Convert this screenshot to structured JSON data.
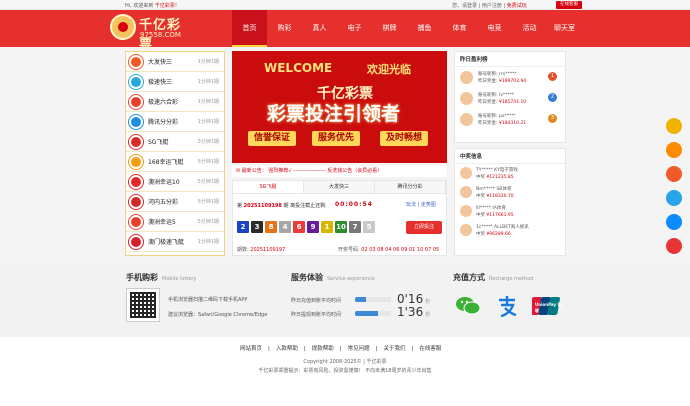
{
  "topbar": {
    "greeting": "Hi, 欢迎来到",
    "site_name": "千亿彩票",
    "greeting_end": "!",
    "right_links": "您，请登录 | 用户注册 |",
    "trial": "免费试玩",
    "service": "在线客服"
  },
  "logo": {
    "name": "千亿彩票",
    "domain": "97558.COM"
  },
  "menu": [
    "首页",
    "购彩",
    "真人",
    "电子",
    "棋牌",
    "捕鱼",
    "体育",
    "电竞",
    "活动",
    "聊天室"
  ],
  "games": [
    {
      "name": "大发快三",
      "time": "1分钟1期",
      "color": "#f15a24"
    },
    {
      "name": "极速快三",
      "time": "1分钟1期",
      "color": "#2aa7dd"
    },
    {
      "name": "极速六合彩",
      "time": "1分钟1期",
      "color": "#e8422f"
    },
    {
      "name": "腾讯分分彩",
      "time": "1分钟1期",
      "color": "#1f8de0"
    },
    {
      "name": "SG飞艇",
      "time": "3分钟1期",
      "color": "#d92a2a"
    },
    {
      "name": "168幸运飞艇",
      "time": "5分钟1期",
      "color": "#f49c11"
    },
    {
      "name": "澳洲幸运10",
      "time": "5分钟1期",
      "color": "#e32626"
    },
    {
      "name": "河内五分彩",
      "time": "5分钟1期",
      "color": "#cf2a2a"
    },
    {
      "name": "澳洲幸运5",
      "time": "5分钟1期",
      "color": "#e8422f"
    },
    {
      "name": "澳门极速飞艇",
      "time": "1分钟1期",
      "color": "#d3202a"
    }
  ],
  "banner": {
    "welcome_en": "WELCOME",
    "welcome_cn": "欢迎光临",
    "brand": "千亿彩票",
    "slogan": "彩票投注引领者",
    "pills": [
      "信誉保证",
      "服务优先",
      "及时畅想"
    ],
    "notice": "最新公告：  强烈推荐√ ------------------  反洗钱公告（会员必看）"
  },
  "lottery": {
    "tabs": [
      "SG飞艇",
      "大发快三",
      "腾讯分分彩"
    ],
    "issue_prefix": "第",
    "issue_number": "20251109198",
    "issue_suffix": "期 离投注截止还剩:",
    "countdown": "00:00:54",
    "links": "玩法 | 走势图",
    "balls": [
      {
        "n": "2",
        "c": "#1c44c2"
      },
      {
        "n": "3",
        "c": "#2b2b2b"
      },
      {
        "n": "8",
        "c": "#e47418"
      },
      {
        "n": "4",
        "c": "#a6a6a6"
      },
      {
        "n": "6",
        "c": "#e93c3c"
      },
      {
        "n": "9",
        "c": "#6a1b9a"
      },
      {
        "n": "1",
        "c": "#d4b800"
      },
      {
        "n": "10",
        "c": "#2e8b2e"
      },
      {
        "n": "7",
        "c": "#777777"
      },
      {
        "n": "5",
        "c": "#c9c9c9"
      }
    ],
    "bet_button": "立即投注",
    "prev_label": "期数:",
    "prev_issue": "20251109197",
    "open_label": "开奖号码:",
    "open_numbers": "02 03 08 04 06 09 01 10 07 05"
  },
  "ranking": {
    "title": "昨日盈利榜",
    "items": [
      {
        "user": "账号昵称: rrn*****",
        "amount_label": "昨日奖金:",
        "amount": "¥189703.94",
        "rank": "1",
        "color": "#e0532b"
      },
      {
        "user": "账号昵称: lv*****",
        "amount_label": "昨日奖金:",
        "amount": "¥185741.10",
        "rank": "2",
        "color": "#3a7ad8"
      },
      {
        "user": "账号昵称: po*****",
        "amount_label": "昨日奖金:",
        "amount": "¥184310.21",
        "rank": "3",
        "color": "#e08a1e"
      }
    ]
  },
  "winners": {
    "title": "中奖信息",
    "items": [
      {
        "user": "TY*****   KY电子游戏",
        "amount_label": "中奖",
        "amount": "¥121235.85"
      },
      {
        "user": "Nm*****   SB体育",
        "amount_label": "中奖",
        "amount": "¥118320.70"
      },
      {
        "user": "lll*****   IA体育",
        "amount_label": "中奖",
        "amount": "¥117661.95"
      },
      {
        "user": "1c*****   ALLBET真人视讯",
        "amount_label": "中奖",
        "amount": "¥96289.66"
      }
    ]
  },
  "side_icons": [
    {
      "name": "chat-icon",
      "color": "#f0b400"
    },
    {
      "name": "headset-icon",
      "color": "#ff8a00"
    },
    {
      "name": "gift-icon",
      "color": "#f25a2a"
    },
    {
      "name": "message-icon",
      "color": "#27a4ea"
    },
    {
      "name": "user-icon",
      "color": "#0a8cff"
    },
    {
      "name": "game-icon",
      "color": "#e53535"
    }
  ],
  "mobile": {
    "title": "手机购彩",
    "title_en": "Mobile lottery",
    "line1": "手机浏览器扫描二维码下载手机APP",
    "line2": "建议浏览器：Safari/Google Chrome/Edge"
  },
  "service_exp": {
    "title": "服务体验",
    "title_en": "Service experience",
    "rows": [
      {
        "label": "昨日充值到账平均时间",
        "value": "0'16",
        "unit": "秒",
        "level": 0.3
      },
      {
        "label": "昨日提现到账平均时间",
        "value": "1'36",
        "unit": "秒",
        "level": 0.65
      }
    ]
  },
  "recharge": {
    "title": "充值方式",
    "title_en": "Recharge method",
    "methods": [
      "wechat-pay-icon",
      "alipay-icon",
      "unionpay-icon"
    ],
    "unionpay_text": "UnionPay 银联"
  },
  "footer": {
    "links": [
      "网站首页",
      "|",
      "入款帮助",
      "|",
      "提款帮助",
      "|",
      "常见问题",
      "|",
      "关于我们",
      "|",
      "在线客服"
    ],
    "copyright": "Copyright  2008-2025©  |  千亿彩票",
    "disclaimer": "千亿彩票郑重提示：彩票有风险，投资需谨慎！  不向未满18周岁的青少年出售"
  }
}
